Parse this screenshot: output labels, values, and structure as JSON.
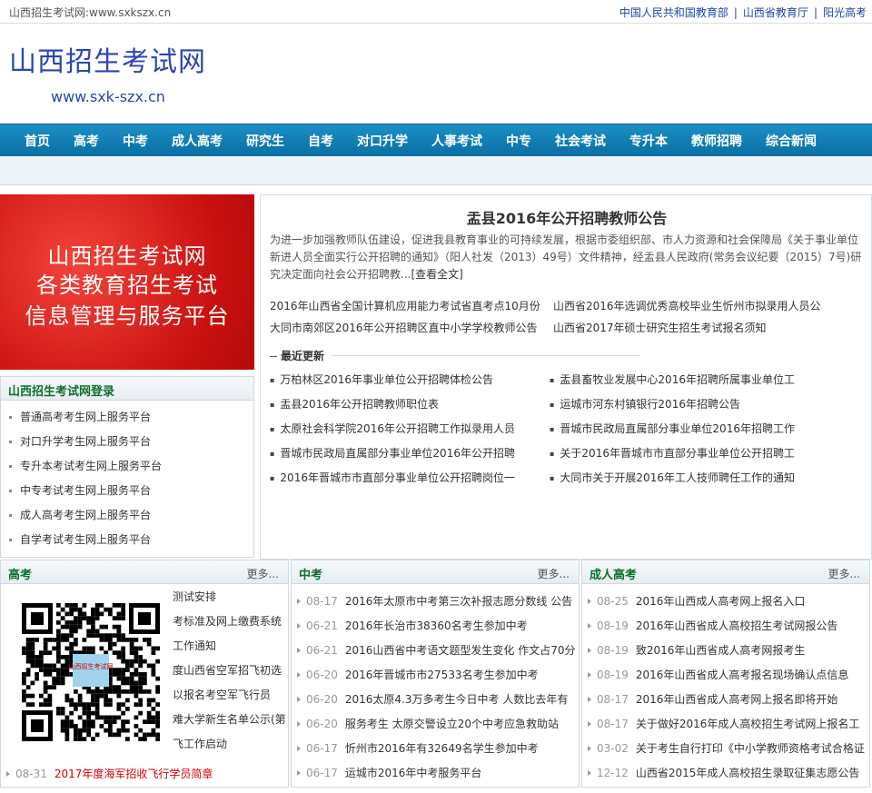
{
  "topbar": {
    "site": "山西招生考试网:www.sxkszx.cn",
    "links": [
      "中国人民共和国教育部",
      "山西省教育厅",
      "阳光高考"
    ],
    "sep": "|"
  },
  "header": {
    "title": "山西招生考试网",
    "url": "www.sxk-szx.cn"
  },
  "nav": [
    "首页",
    "高考",
    "中考",
    "成人高考",
    "研究生",
    "自考",
    "对口升学",
    "人事考试",
    "中专",
    "社会考试",
    "专升本",
    "教师招聘",
    "综合新闻"
  ],
  "banner": {
    "lines": [
      "山西招生考试网",
      "各类教育招生考试",
      "信息管理与服务平台"
    ]
  },
  "login": {
    "title": "山西招生考试网登录",
    "items": [
      "普通高考考生网上服务平台",
      "对口升学考生网上服务平台",
      "专升本考试考生网上服务平台",
      "中专考试考生网上服务平台",
      "成人高考考生网上服务平台",
      "自学考试考生网上服务平台"
    ]
  },
  "main": {
    "headline": "盂县2016年公开招聘教师公告",
    "summary": "为进一步加强教师队伍建设，促进我县教育事业的可持续发展，根据市委组织部、市人力资源和社会保障局《关于事业单位新进人员全面实行公开招聘的通知》（阳人社发（2013）49号）文件精神，经盂县人民政府(常务会议纪要（2015）7号)研究决定面向社会公开招聘教...",
    "fullread": "[查看全文]",
    "hot": [
      [
        "2016年山西省全国计算机应用能力考试省直考点10月份",
        "山西省2016年选调优秀高校毕业生忻州市拟录用人员公"
      ],
      [
        "大同市南郊区2016年公开招聘区直中小学学校教师公告",
        "山西省2017年硕士研究生招生考试报名须知"
      ]
    ],
    "latest_title": "最近更新",
    "latest": [
      [
        "万柏林区2016年事业单位公开招聘体检公告",
        "盂县畜牧业发展中心2016年招聘所属事业单位工"
      ],
      [
        "盂县2016年公开招聘教师职位表",
        "运城市河东村镇银行2016年招聘公告"
      ],
      [
        "太原社会科学院2016年公开招聘工作拟录用人员",
        "晋城市民政局直属部分事业单位2016年招聘工作"
      ],
      [
        "晋城市民政局直属部分事业单位2016年公开招聘",
        "关于2016年晋城市市直部分事业单位公开招聘工"
      ],
      [
        "2016年晋城市市直部分事业单位公开招聘岗位一",
        "大同市关于开展2016年工人技师聘任工作的通知"
      ]
    ]
  },
  "columns": {
    "more": "更多...",
    "gaokao": {
      "title": "高考",
      "clipped": [
        "测试安排",
        "考标准及网上缴费系统",
        "工作通知",
        "度山西省空军招飞初选",
        "以报名考空军飞行员",
        "难大学新生名单公示(第",
        "飞工作启动"
      ],
      "last_date": "08-31",
      "last_text": "2017年度海军招收飞行学员简章"
    },
    "zhongkao": {
      "title": "中考",
      "items": [
        {
          "d": "08-17",
          "t": "2016年太原市中考第三次补报志愿分数线 公告"
        },
        {
          "d": "06-21",
          "t": "2016年长治市38360名考生参加中考"
        },
        {
          "d": "06-21",
          "t": "2016山西省中考语文题型发生变化 作文占70分"
        },
        {
          "d": "06-20",
          "t": "2016年晋城市市27533名考生参加中考"
        },
        {
          "d": "06-20",
          "t": "2016太原4.3万多考生今日中考 人数比去年有"
        },
        {
          "d": "06-20",
          "t": "服务考生 太原交警设立20个中考应急救助站"
        },
        {
          "d": "06-17",
          "t": "忻州市2016年有32649名学生参加中考"
        },
        {
          "d": "06-17",
          "t": "运城市2016年中考服务平台"
        }
      ]
    },
    "chengkao": {
      "title": "成人高考",
      "items": [
        {
          "d": "08-25",
          "t": "2016年山西成人高考网上报名入口"
        },
        {
          "d": "08-19",
          "t": "2016年山西省成人高校招生考试网报公告"
        },
        {
          "d": "08-19",
          "t": "致2016年山西省成人高考网报考生"
        },
        {
          "d": "08-19",
          "t": "2016年山西省成人高考报名现场确认点信息"
        },
        {
          "d": "08-17",
          "t": "2016年山西省成人高考网上报名即将开始"
        },
        {
          "d": "08-17",
          "t": "关于做好2016年成人高校招生考试网上报名工"
        },
        {
          "d": "03-02",
          "t": "关于考生自行打印《中小学教师资格考试合格证"
        },
        {
          "d": "12-12",
          "t": "山西省2015年成人高校招生录取征集志愿公告"
        }
      ]
    }
  },
  "qr": {
    "stamp": "山西招生考试网"
  },
  "colors": {
    "brand": "#2b46b3",
    "nav": "#0a6ea3",
    "accent_red": "#d40000",
    "section_green": "#0d6f2c"
  }
}
